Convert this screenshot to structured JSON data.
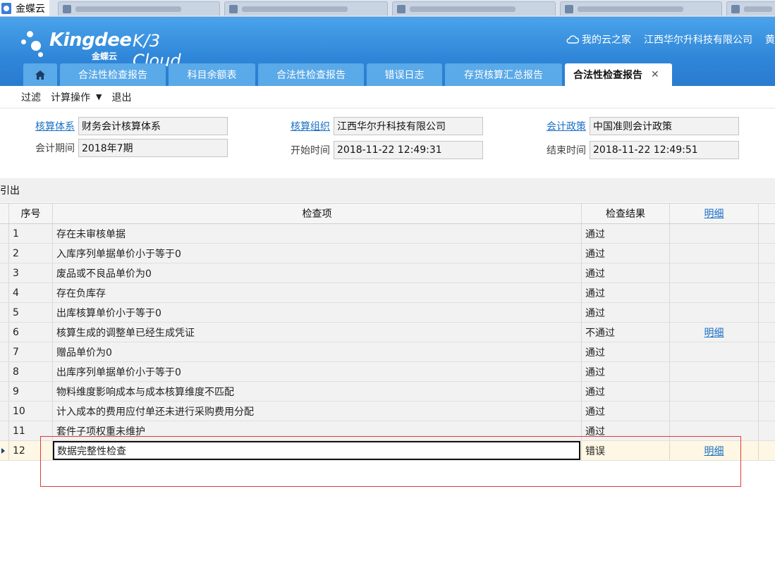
{
  "browser": {
    "window_title": "金蝶云"
  },
  "header": {
    "brand": "Kingdee",
    "brand_cn": "金蝶云",
    "product": "K/3 Cloud",
    "my_cloud": "我的云之家",
    "company": "江西华尔升科技有限公司",
    "user": "黄"
  },
  "app_tabs": [
    {
      "label": "合法性检查报告"
    },
    {
      "label": "科目余额表"
    },
    {
      "label": "合法性检查报告"
    },
    {
      "label": "错误日志"
    },
    {
      "label": "存货核算汇总报告"
    },
    {
      "label": "合法性检查报告",
      "active": true
    }
  ],
  "toolbar": {
    "filter": "过滤",
    "calc": "计算操作",
    "exit": "退出"
  },
  "form": {
    "acct_system_label": "核算体系",
    "acct_system_value": "财务会计核算体系",
    "acct_org_label": "核算组织",
    "acct_org_value": "江西华尔升科技有限公司",
    "acct_policy_label": "会计政策",
    "acct_policy_value": "中国准则会计政策",
    "period_label": "会计期间",
    "period_value": "2018年7期",
    "start_label": "开始时间",
    "start_value": "2018-11-22 12:49:31",
    "end_label": "结束时间",
    "end_value": "2018-11-22 12:49:51"
  },
  "section_label": "引出",
  "grid": {
    "headers": {
      "seq": "序号",
      "item": "检查项",
      "result": "检查结果",
      "detail": "明细"
    },
    "rows": [
      {
        "seq": "1",
        "item": "存在未审核单据",
        "result": "通过",
        "detail": ""
      },
      {
        "seq": "2",
        "item": "入库序列单据单价小于等于0",
        "result": "通过",
        "detail": ""
      },
      {
        "seq": "3",
        "item": "废品或不良品单价为0",
        "result": "通过",
        "detail": ""
      },
      {
        "seq": "4",
        "item": "存在负库存",
        "result": "通过",
        "detail": ""
      },
      {
        "seq": "5",
        "item": "出库核算单价小于等于0",
        "result": "通过",
        "detail": ""
      },
      {
        "seq": "6",
        "item": "核算生成的调整单已经生成凭证",
        "result": "不通过",
        "detail": "明细"
      },
      {
        "seq": "7",
        "item": "赠品单价为0",
        "result": "通过",
        "detail": ""
      },
      {
        "seq": "8",
        "item": "出库序列单据单价小于等于0",
        "result": "通过",
        "detail": ""
      },
      {
        "seq": "9",
        "item": "物料维度影响成本与成本核算维度不匹配",
        "result": "通过",
        "detail": ""
      },
      {
        "seq": "10",
        "item": "计入成本的费用应付单还未进行采购费用分配",
        "result": "通过",
        "detail": ""
      },
      {
        "seq": "11",
        "item": "套件子项权重未维护",
        "result": "通过",
        "detail": ""
      },
      {
        "seq": "12",
        "item": "数据完整性检查",
        "result": "错误",
        "detail": "明细",
        "current": true
      }
    ]
  }
}
